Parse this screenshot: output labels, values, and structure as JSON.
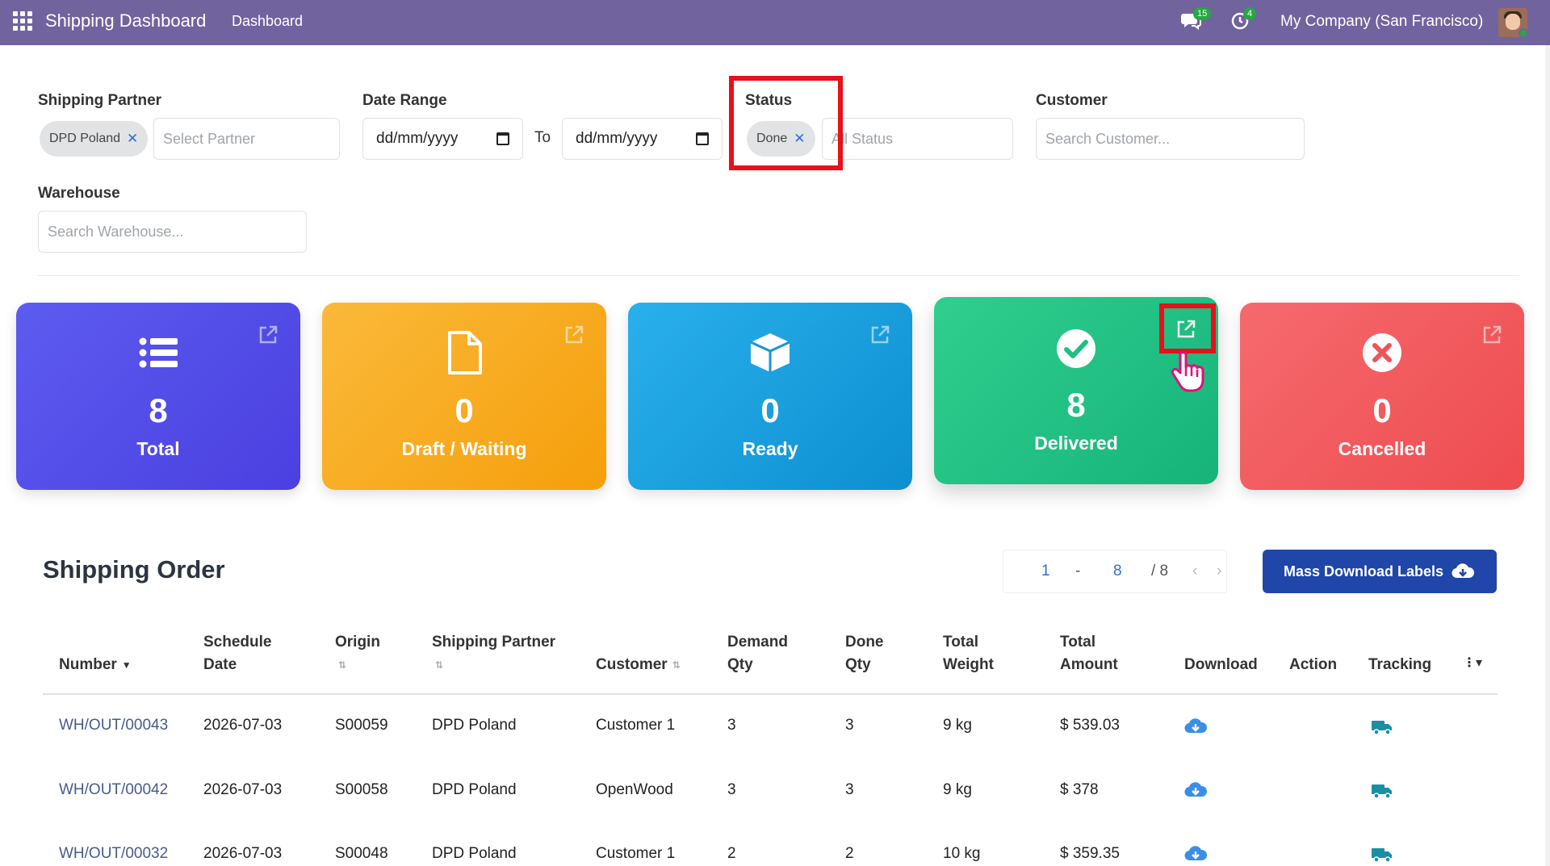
{
  "topbar": {
    "app_title": "Shipping Dashboard",
    "menu_item": "Dashboard",
    "messages_count": "15",
    "activities_count": "4",
    "company": "My Company (San Francisco)"
  },
  "filters": {
    "shipping_partner": {
      "label": "Shipping Partner",
      "chip": "DPD Poland",
      "placeholder": "Select Partner"
    },
    "date_range": {
      "label": "Date Range",
      "from_placeholder": "dd/mm/yyyy",
      "to_label": "To",
      "to_placeholder": "dd/mm/yyyy"
    },
    "status": {
      "label": "Status",
      "chip": "Done",
      "placeholder": "All Status"
    },
    "customer": {
      "label": "Customer",
      "placeholder": "Search Customer..."
    },
    "warehouse": {
      "label": "Warehouse",
      "placeholder": "Search Warehouse..."
    }
  },
  "cards": {
    "total": {
      "count": "8",
      "label": "Total"
    },
    "draft": {
      "count": "0",
      "label": "Draft / Waiting"
    },
    "ready": {
      "count": "0",
      "label": "Ready"
    },
    "delivered": {
      "count": "8",
      "label": "Delivered"
    },
    "cancelled": {
      "count": "0",
      "label": "Cancelled"
    }
  },
  "orders": {
    "title": "Shipping Order",
    "pager": {
      "from": "1",
      "sep": "-",
      "to": "8",
      "total": "/ 8"
    },
    "mass_download_label": "Mass Download Labels",
    "columns": {
      "number": "Number",
      "schedule_date_1": "Schedule",
      "schedule_date_2": "Date",
      "origin": "Origin",
      "shipping_partner": "Shipping Partner",
      "customer": "Customer",
      "demand_qty_1": "Demand",
      "demand_qty_2": "Qty",
      "done_qty_1": "Done",
      "done_qty_2": "Qty",
      "total_weight_1": "Total",
      "total_weight_2": "Weight",
      "total_amount_1": "Total",
      "total_amount_2": "Amount",
      "download": "Download",
      "action": "Action",
      "tracking": "Tracking"
    },
    "rows": [
      {
        "number": "WH/OUT/00043",
        "date": "2026-07-03",
        "origin": "S00059",
        "partner": "DPD Poland",
        "customer": "Customer 1",
        "demand": "3",
        "done": "3",
        "weight": "9 kg",
        "amount": "$ 539.03"
      },
      {
        "number": "WH/OUT/00042",
        "date": "2026-07-03",
        "origin": "S00058",
        "partner": "DPD Poland",
        "customer": "OpenWood",
        "demand": "3",
        "done": "3",
        "weight": "9 kg",
        "amount": "$ 378"
      },
      {
        "number": "WH/OUT/00032",
        "date": "2026-07-03",
        "origin": "S00048",
        "partner": "DPD Poland",
        "customer": "Customer 1",
        "demand": "2",
        "done": "2",
        "weight": "10 kg",
        "amount": "$ 359.35"
      }
    ]
  },
  "colors": {
    "topbar": "#71639e",
    "total_card": "#5c5cf0",
    "draft_card": "#f5a623",
    "ready_card": "#1ea4e4",
    "delivered_card": "#22c484",
    "cancelled_card": "#f05a5e",
    "highlight": "#e8101a",
    "primary_button": "#1f46a8"
  }
}
